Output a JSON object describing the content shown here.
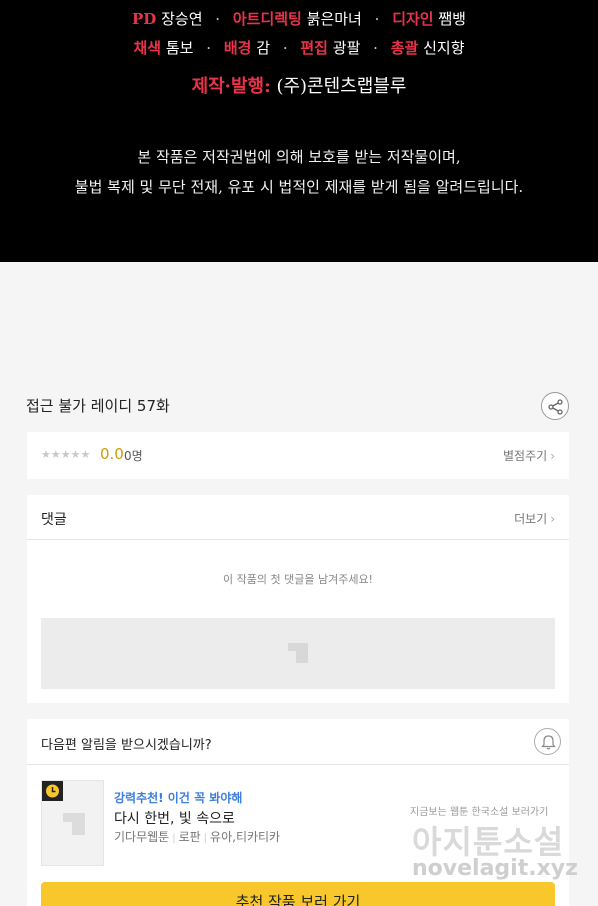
{
  "credits": {
    "line1": [
      {
        "role": "PD",
        "name": "장승연"
      },
      {
        "role": "아트디렉팅",
        "name": "붉은마녀"
      },
      {
        "role": "디자인",
        "name": "쨈뱅"
      }
    ],
    "line2": [
      {
        "role": "채색",
        "name": "톰보"
      },
      {
        "role": "배경",
        "name": "감"
      },
      {
        "role": "편집",
        "name": "광팔"
      },
      {
        "role": "총괄",
        "name": "신지향"
      }
    ],
    "producer": {
      "role": "제작·발행:",
      "name": "(주)콘텐츠랩블루"
    },
    "notice_line1": "본 작품은 저작권법에 의해 보호를 받는 저작물이며,",
    "notice_line2": "불법 복제 및 무단 전재, 유포 시 법적인 제재를 받게 됨을 알려드립니다."
  },
  "episode": {
    "title": "접근 불가 레이디 57화"
  },
  "rating": {
    "stars": "★★★★★",
    "score": "0.0",
    "count": "0명",
    "action": "별점주기"
  },
  "comments": {
    "title": "댓글",
    "more": "더보기",
    "empty": "이 작품의 첫 댓글을 남겨주세요!"
  },
  "notify": {
    "question": "다음편 알림을 받으시겠습니까?",
    "recommend": {
      "tag": "강력추천! 이건 꼭 봐야해",
      "title": "다시 한번, 빛 속으로",
      "meta": [
        "기다무웹툰",
        "로판",
        "유아,티카티카"
      ]
    },
    "cta": "추천 작품 보러 가기"
  },
  "watermark": {
    "small": "지금보는 웹툰 한국소설 보러가기",
    "big": "아지툰소설",
    "url": "novelagit.xyz"
  },
  "colors": {
    "accent_red": "#e8334a",
    "rating_gold": "#d29c00",
    "link_blue": "#3d7de0",
    "cta_yellow": "#f7c72c"
  }
}
